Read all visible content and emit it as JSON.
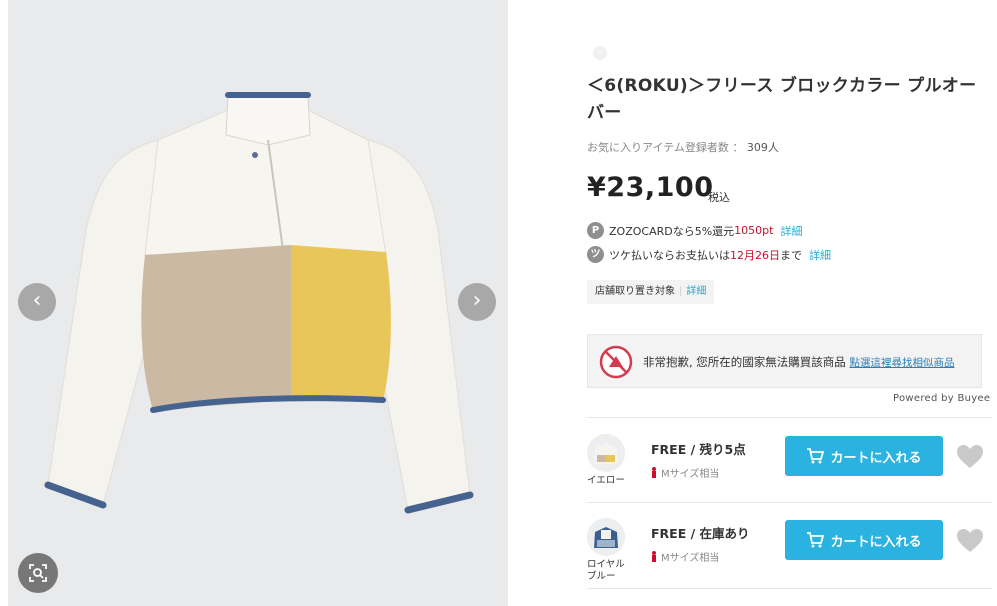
{
  "gallery": {
    "prev_glyph": "‹",
    "next_glyph": "›",
    "icons": {
      "prev": "chevron-left-icon",
      "next": "chevron-right-icon",
      "zoom": "image-search-icon"
    }
  },
  "product": {
    "title": "＜6(ROKU)＞フリース ブロックカラー プルオーバー",
    "favorites_label": "お気に入りアイテム登録者数 ：",
    "favorites_count": "309人",
    "price": "¥23,100",
    "tax_label": "税込"
  },
  "promos": [
    {
      "badge": "P",
      "text_pre": "ZOZOCARDなら5%還元",
      "highlight": "1050pt",
      "text_post": "",
      "link": "詳細"
    },
    {
      "badge": "ツ",
      "text_pre": "ツケ払いならお支払いは",
      "highlight": "12月26日",
      "text_post": "まで",
      "link": "詳細"
    }
  ],
  "store_tag": {
    "label": "店舗取り置き対象",
    "link": "詳細"
  },
  "buyee": {
    "message": "非常抱歉, 您所在的國家無法購買該商品",
    "link": "點選這裡尋找相似商品",
    "powered_by": "Powered by Buyee"
  },
  "skus": [
    {
      "color": "イエロー",
      "stock": "FREE / 残り5点",
      "size_hint": "Mサイズ相当",
      "cart_label": "カートに入れる"
    },
    {
      "color": "ロイヤルブルー",
      "stock": "FREE / 在庫あり",
      "size_hint": "Mサイズ相当",
      "cart_label": "カートに入れる"
    }
  ],
  "colors": {
    "accent_blue": "#2ab2e0",
    "price_red": "#c8102e",
    "link_blue": "#2aa7d6",
    "jacket_beige": "#cbb9a4",
    "jacket_yellow": "#e9c65a",
    "jacket_trim": "#46628f"
  }
}
